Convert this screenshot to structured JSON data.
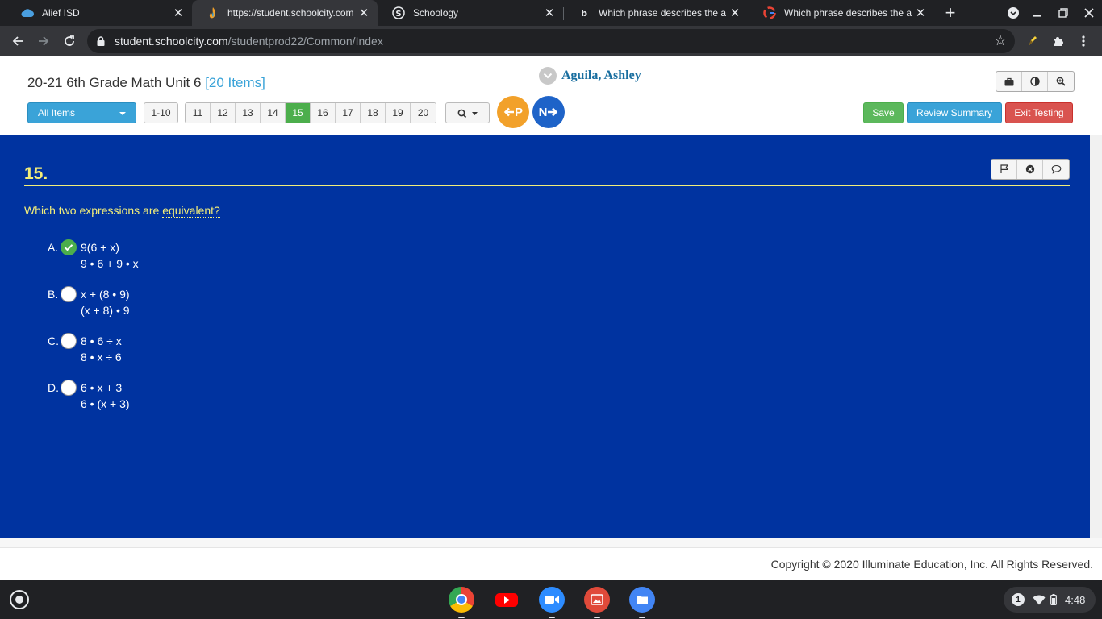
{
  "browser": {
    "tabs": [
      {
        "title": "Alief ISD",
        "favicon": "alief-cloud-icon"
      },
      {
        "title": "https://student.schoolcity.com",
        "favicon": "schoolcity-flame-icon",
        "active": true
      },
      {
        "title": "Schoology",
        "favicon": "schoology-icon"
      },
      {
        "title": "Which phrase describes the alg",
        "favicon": "brainly-icon"
      },
      {
        "title": "Which phrase describes the alg",
        "favicon": "google-icon"
      }
    ],
    "url_host": "student.schoolcity.com",
    "url_path": "/studentprod22/Common/Index"
  },
  "header": {
    "test_title": "20-21 6th Grade Math Unit 6",
    "item_count": "[20 Items]",
    "student_name": "Aguila, Ashley",
    "items_dropdown_label": "All Items",
    "range_label": "1-10",
    "pages": [
      "11",
      "12",
      "13",
      "14",
      "15",
      "16",
      "17",
      "18",
      "19",
      "20"
    ],
    "current_page": "15",
    "prev_label": "P",
    "next_label": "N",
    "save_label": "Save",
    "review_label": "Review Summary",
    "exit_label": "Exit Testing"
  },
  "question": {
    "number": "15.",
    "stem_prefix": "Which two expressions are ",
    "stem_term": "equivalent?",
    "selected": "A",
    "choices": [
      {
        "letter": "A.",
        "line1": "9(6 + x)",
        "line2": "9 • 6 + 9 • x"
      },
      {
        "letter": "B.",
        "line1": "x + (8 • 9)",
        "line2": "(x + 8) • 9"
      },
      {
        "letter": "C.",
        "line1": "8 • 6 ÷ x",
        "line2": "8 • x ÷ 6"
      },
      {
        "letter": "D.",
        "line1": "6 • x + 3",
        "line2": "6 • (x + 3)"
      }
    ]
  },
  "footer": {
    "copyright": "Copyright © 2020 Illuminate Education, Inc. All Rights Reserved."
  },
  "shelf": {
    "notification_count": "1",
    "time": "4:48"
  },
  "colors": {
    "question_bg": "#0033a0",
    "question_text": "#f3ee79",
    "primary_blue": "#3aa3d8",
    "success_green": "#5cb85c",
    "danger_red": "#d9534f",
    "prev_orange": "#f2a12a",
    "next_blue": "#1e63c8"
  }
}
